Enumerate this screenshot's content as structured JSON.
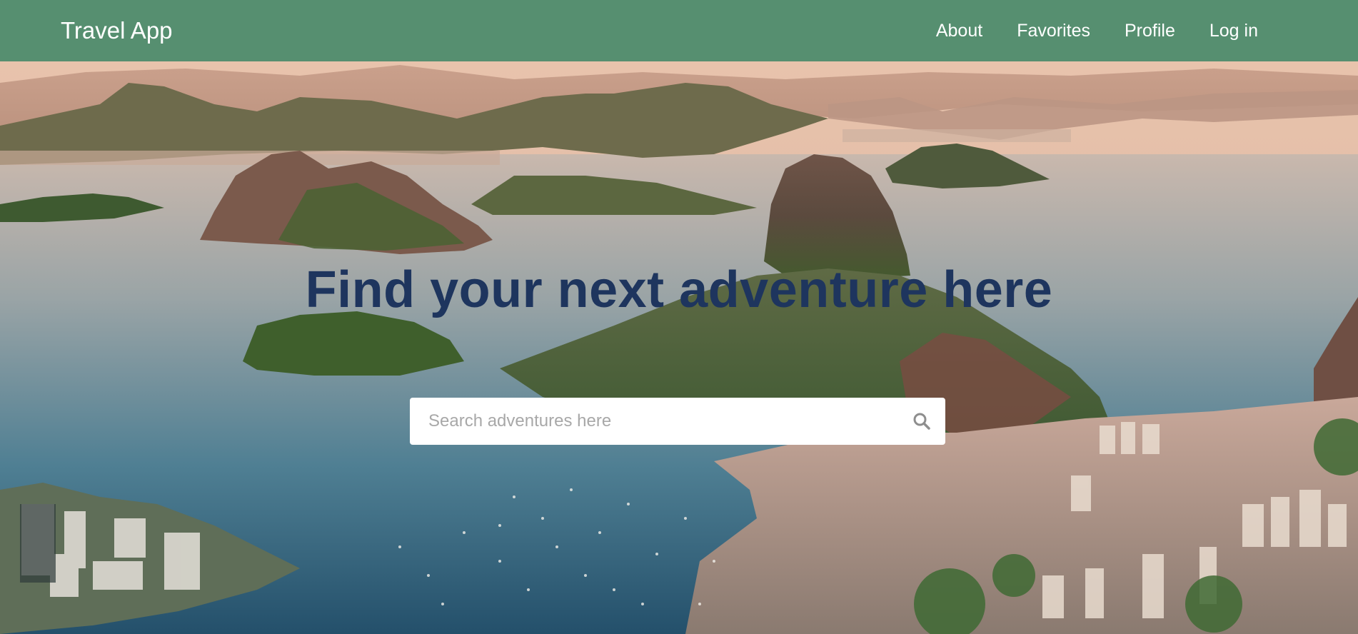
{
  "app": {
    "brand": "Travel App"
  },
  "nav": {
    "items": [
      {
        "label": "About"
      },
      {
        "label": "Favorites"
      },
      {
        "label": "Profile"
      },
      {
        "label": "Log in"
      }
    ]
  },
  "hero": {
    "headline": "Find your next adventure here",
    "background": "aerial-bay-city-mountains"
  },
  "search": {
    "placeholder": "Search adventures here",
    "value": "",
    "icon": "search-icon"
  },
  "colors": {
    "navbar": "#568f70",
    "headline": "#1e355e",
    "nav_text": "#ffffff"
  }
}
